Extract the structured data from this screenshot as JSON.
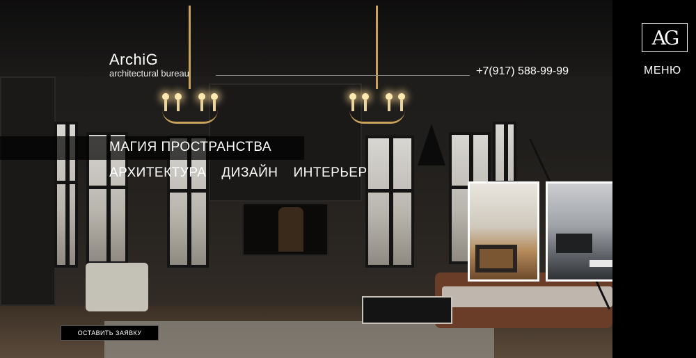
{
  "brand": {
    "name": "ArchiG",
    "subtitle": "architectural bureau",
    "mark": "AG"
  },
  "header": {
    "phone": "+7(917) 588-99-99",
    "menu_label": "МЕНЮ"
  },
  "hero": {
    "tagline": "МАГИЯ ПРОСТРАНСТВА",
    "services": [
      "АРХИТЕКТУРА",
      "ДИЗАЙН",
      "ИНТЕРЬЕР"
    ],
    "cta_label": "ОСТАВИТЬ ЗАЯВКУ"
  },
  "colors": {
    "background": "#000000",
    "text": "#ffffff",
    "accent_gold": "#c9a35a"
  }
}
